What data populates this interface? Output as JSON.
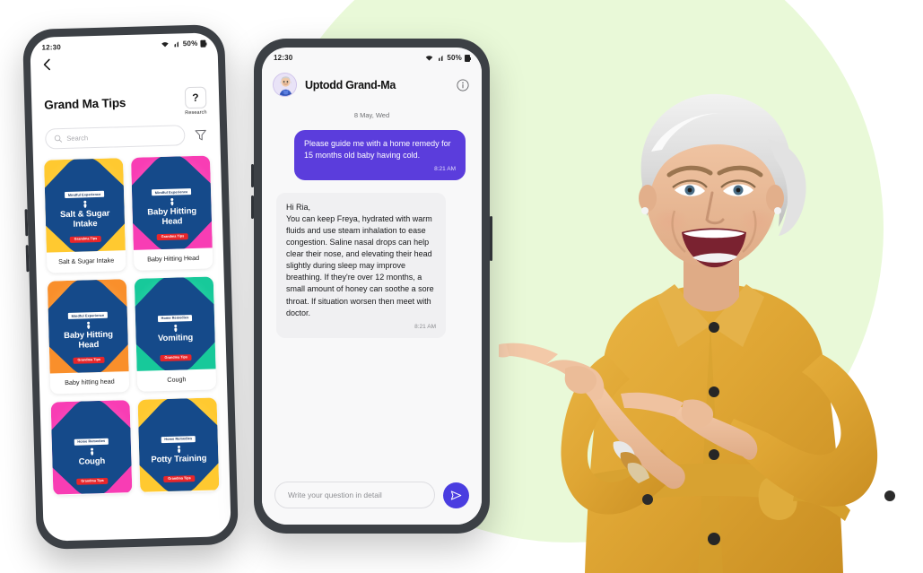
{
  "left_phone": {
    "status": {
      "time": "12:30",
      "battery": "50%",
      "icons": [
        "wifi-icon",
        "signal-icon",
        "battery-icon"
      ]
    },
    "back_icon": "chevron-left-icon",
    "title": "Grand Ma Tips",
    "research": {
      "symbol": "?",
      "label": "Research"
    },
    "search": {
      "placeholder": "Search",
      "icon": "search-icon"
    },
    "filter_icon": "filter-funnel-icon",
    "cards": [
      {
        "label": "Salt & Sugar Intake",
        "art_title": "Salt & Sugar Intake",
        "top_pill": "Mindful Experience",
        "bottom_pill": "Grandma Tips",
        "bg": "#FFC930",
        "bg2": "#FFD95E",
        "diamond": "#154A8A"
      },
      {
        "label": "Baby Hitting Head",
        "art_title": "Baby Hitting Head",
        "top_pill": "Mindful Experience",
        "bottom_pill": "Grandma Tips",
        "bg": "#F83DB4",
        "bg2": "#FF6BC9",
        "diamond": "#154A8A"
      },
      {
        "label": "Baby hitting head",
        "art_title": "Baby Hitting Head",
        "top_pill": "Mindful Experience",
        "bottom_pill": "Grandma Tips",
        "bg": "#F98F2B",
        "bg2": "#FBB457",
        "diamond": "#154A8A"
      },
      {
        "label": "Cough",
        "art_title": "Vomiting",
        "top_pill": "Home Remedies",
        "bottom_pill": "Grandma Tips",
        "bg": "#17C99A",
        "bg2": "#4BE0BA",
        "diamond": "#154A8A"
      },
      {
        "label": "",
        "art_title": "Cough",
        "top_pill": "Home Remedies",
        "bottom_pill": "Grandma Tips",
        "bg": "#F83DB4",
        "bg2": "#FF6BC9",
        "diamond": "#154A8A"
      },
      {
        "label": "",
        "art_title": "Potty Training",
        "top_pill": "Home Remedies",
        "bottom_pill": "Grandma Tips",
        "bg": "#FFC930",
        "bg2": "#FFD95E",
        "diamond": "#154A8A"
      }
    ]
  },
  "right_phone": {
    "status": {
      "time": "12:30",
      "battery": "50%"
    },
    "header": {
      "name": "Uptodd Grand-Ma",
      "avatar_icon": "grandma-avatar",
      "info_icon": "info-circle-icon"
    },
    "date_divider": "8 May, Wed",
    "messages": [
      {
        "from": "user",
        "text": "Please guide me with a home remedy for 15 months old baby having cold.",
        "time": "8:21 AM"
      },
      {
        "from": "bot",
        "text": "Hi Ria,\nYou can keep Freya, hydrated with warm fluids and use steam inhalation to ease congestion. Saline nasal drops can help clear their nose, and elevating their head slightly during sleep may improve breathing. If they're over 12 months, a small amount of honey can soothe a sore throat. If situation worsen then meet with doctor.",
        "time": "8:21 AM"
      }
    ],
    "composer": {
      "placeholder": "Write your question in detail",
      "send_icon": "send-paper-plane-icon"
    }
  },
  "decor": {
    "circle_color": "#E9F9D8",
    "accent_purple": "#4A3DE0",
    "photo_alt": "laughing-senior-woman-pointing-left"
  }
}
